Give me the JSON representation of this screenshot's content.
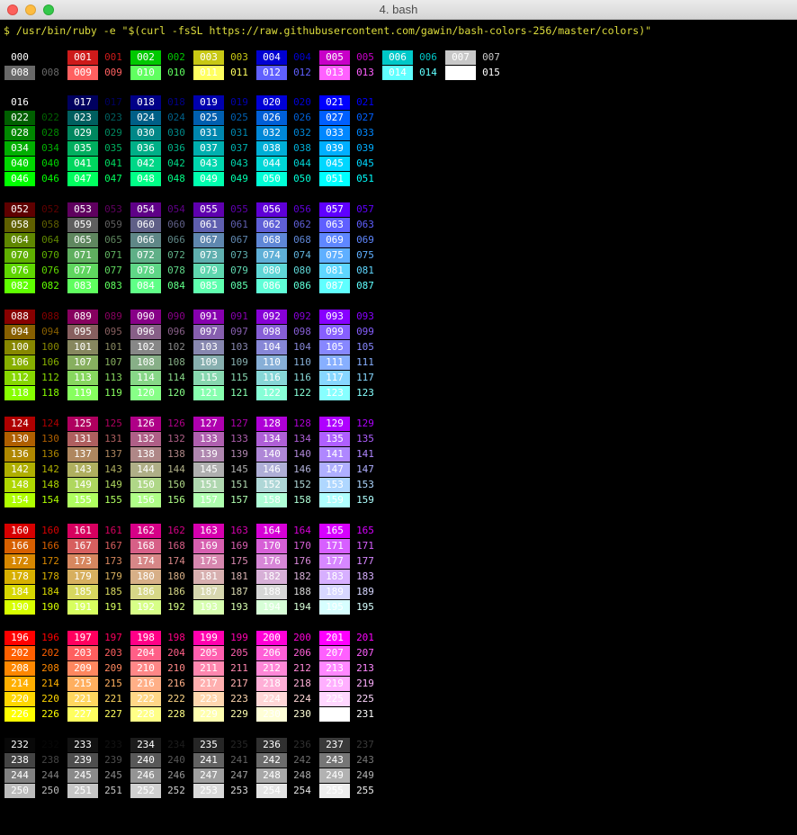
{
  "window": {
    "title": "4. bash"
  },
  "terminal": {
    "prompt_line": "$ /usr/bin/ruby -e \"$(curl -fsSL https://raw.githubusercontent.com/gawin/bash-colors-256/master/colors)\""
  },
  "colors": {
    "system": [
      "#000000",
      "#cd1a1a",
      "#00c800",
      "#c8c814",
      "#0000d2",
      "#c800c8",
      "#00c8c8",
      "#c8c8c8",
      "#686868",
      "#ff6060",
      "#60ff60",
      "#ffff60",
      "#6060ff",
      "#ff60ff",
      "#60ffff",
      "#ffffff"
    ],
    "cube_levels": [
      0,
      95,
      135,
      175,
      215,
      255
    ],
    "prompt_color": "#dcdc3c",
    "background": "#000000"
  }
}
